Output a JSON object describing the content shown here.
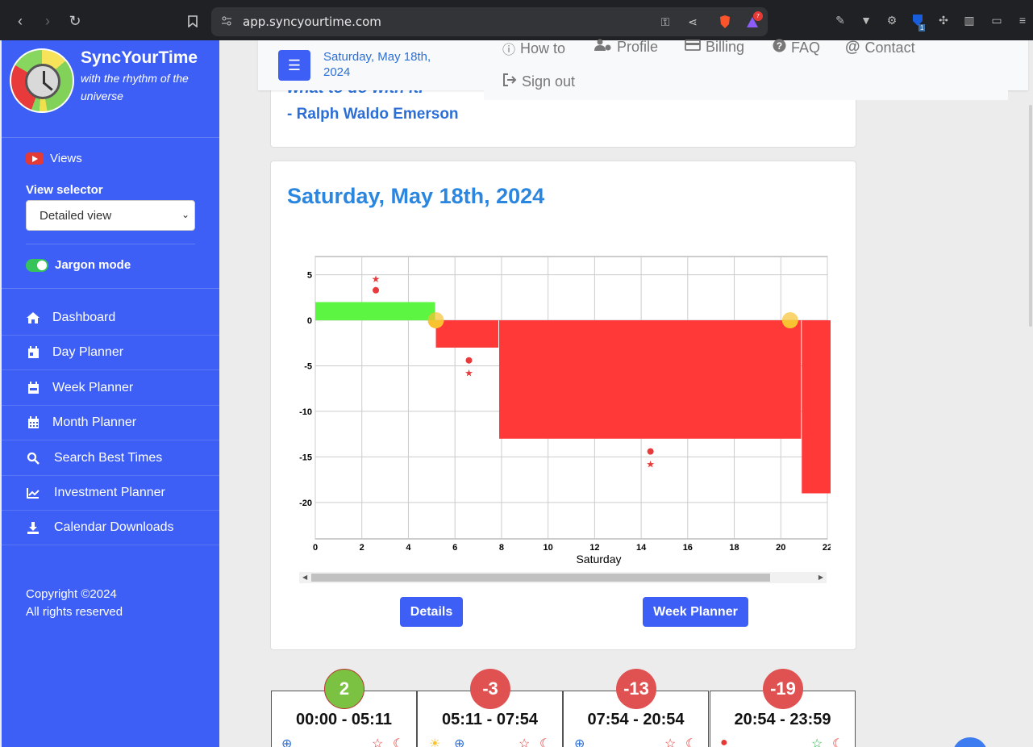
{
  "browser": {
    "url": "app.syncyourtime.com",
    "ext_badge": "7",
    "ext_counter": "1"
  },
  "sidebar": {
    "brand_title": "SyncYourTime",
    "brand_subtitle": "with the rhythm of the universe",
    "views_label": "Views",
    "view_selector_label": "View selector",
    "view_selector_value": "Detailed view",
    "jargon_label": "Jargon mode",
    "jargon_on": true,
    "menu": [
      {
        "label": "Dashboard",
        "icon": "home-icon"
      },
      {
        "label": "Day Planner",
        "icon": "calendar-day-icon"
      },
      {
        "label": "Week Planner",
        "icon": "calendar-week-icon"
      },
      {
        "label": "Month Planner",
        "icon": "calendar-month-icon"
      },
      {
        "label": "Search Best Times",
        "icon": "search-icon"
      },
      {
        "label": "Investment Planner",
        "icon": "chart-line-icon"
      },
      {
        "label": "Calendar Downloads",
        "icon": "download-icon"
      }
    ],
    "copyright_line1": "Copyright ©2024",
    "copyright_line2": "All rights reserved"
  },
  "topnav": {
    "date": "Saturday, May 18th, 2024",
    "links": [
      {
        "label": "How to",
        "icon": "info-icon"
      },
      {
        "label": "Profile",
        "icon": "user-cog-icon"
      },
      {
        "label": "Billing",
        "icon": "credit-card-icon"
      },
      {
        "label": "FAQ",
        "icon": "question-icon"
      },
      {
        "label": "Contact",
        "icon": "at-icon"
      },
      {
        "label": "Sign out",
        "icon": "sign-out-icon"
      }
    ]
  },
  "quote": {
    "tail": "what to do with it.",
    "author": "- Ralph Waldo Emerson"
  },
  "day_card": {
    "title": "Saturday, May 18th, 2024",
    "details_button": "Details",
    "week_button": "Week Planner"
  },
  "colors": {
    "positive": "#5cf542",
    "negative": "#ff3838",
    "sun_marker": "#f8c230",
    "accent": "#3d5ff5"
  },
  "chart_data": {
    "type": "bar",
    "xlabel": "Saturday",
    "ylabel": "",
    "xlim": [
      0,
      22
    ],
    "ylim": [
      -24,
      7
    ],
    "x_ticks": [
      0,
      2,
      4,
      6,
      8,
      10,
      12,
      14,
      16,
      18,
      20,
      22
    ],
    "y_ticks": [
      5,
      0,
      -5,
      -10,
      -15,
      -20
    ],
    "x_tick_labels": [
      "0",
      "2",
      "4",
      "6",
      "8",
      "10",
      "12",
      "14",
      "16",
      "18",
      "20",
      "22"
    ],
    "y_tick_labels": [
      "5",
      "0",
      "-5",
      "-10",
      "-15",
      "-20"
    ],
    "grid": true,
    "segments": [
      {
        "start": 0,
        "end": 5.18,
        "value": 2
      },
      {
        "start": 5.18,
        "end": 7.9,
        "value": -3
      },
      {
        "start": 7.9,
        "end": 20.9,
        "value": -13
      },
      {
        "start": 20.9,
        "end": 23.98,
        "value": -19
      }
    ],
    "markers": [
      {
        "x": 2.6,
        "y": 4.5,
        "symbol": "star"
      },
      {
        "x": 2.6,
        "y": 3.3,
        "symbol": "dot"
      },
      {
        "x": 6.6,
        "y": -4.4,
        "symbol": "dot"
      },
      {
        "x": 6.6,
        "y": -5.8,
        "symbol": "star"
      },
      {
        "x": 14.4,
        "y": -14.4,
        "symbol": "dot"
      },
      {
        "x": 14.4,
        "y": -15.8,
        "symbol": "star"
      }
    ],
    "sun_events": [
      {
        "x": 5.18,
        "y": 0
      },
      {
        "x": 20.4,
        "y": 0
      }
    ]
  },
  "periods": [
    {
      "value": "2",
      "time": "00:00 - 05:11",
      "color": "#7bc142"
    },
    {
      "value": "-3",
      "time": "05:11 - 07:54",
      "color": "#e05252"
    },
    {
      "value": "-13",
      "time": "07:54 - 20:54",
      "color": "#e05252"
    },
    {
      "value": "-19",
      "time": "20:54 - 23:59",
      "color": "#e05252"
    }
  ]
}
